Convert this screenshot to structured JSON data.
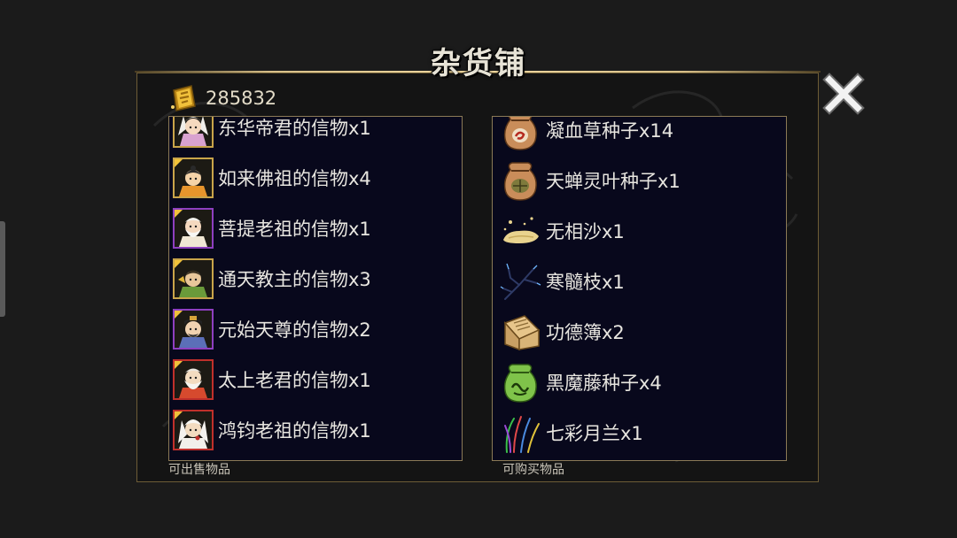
{
  "shop": {
    "title": "杂货铺",
    "currency": {
      "icon": "gold-ingot-icon",
      "amount": "285832"
    },
    "close_icon": "close-icon",
    "sell_label": "可出售物品",
    "buy_label": "可购买物品"
  },
  "sell_items": [
    {
      "name": "东华帝君的信物x1",
      "icon": "donghua-dijun-portrait",
      "rarity": "gold"
    },
    {
      "name": "如来佛祖的信物x4",
      "icon": "rulai-fozu-portrait",
      "rarity": "gold"
    },
    {
      "name": "菩提老祖的信物x1",
      "icon": "puti-laozu-portrait",
      "rarity": "purple"
    },
    {
      "name": "通天教主的信物x3",
      "icon": "tongtian-jiaozhu-portrait",
      "rarity": "gold"
    },
    {
      "name": "元始天尊的信物x2",
      "icon": "yuanshi-tianzun-portrait",
      "rarity": "purple"
    },
    {
      "name": "太上老君的信物x1",
      "icon": "taishang-laojun-portrait",
      "rarity": "red"
    },
    {
      "name": "鸿钧老祖的信物x1",
      "icon": "hongjun-laozu-portrait",
      "rarity": "red"
    }
  ],
  "buy_items": [
    {
      "name": "凝血草种子x14",
      "icon": "seed-bag-red-icon"
    },
    {
      "name": "天蝉灵叶种子x1",
      "icon": "seed-bag-green-icon"
    },
    {
      "name": "无相沙x1",
      "icon": "sand-pile-icon"
    },
    {
      "name": "寒髓枝x1",
      "icon": "blue-branch-icon"
    },
    {
      "name": "功德簿x2",
      "icon": "scroll-book-icon"
    },
    {
      "name": "黑魔藤种子x4",
      "icon": "seed-bag-lime-icon"
    },
    {
      "name": "七彩月兰x1",
      "icon": "rainbow-orchid-icon"
    }
  ],
  "colors": {
    "background": "#1b1b1b",
    "list_background": "#08081c",
    "frame_gold": "#d8c089",
    "rarity_gold": "#c9a44a",
    "rarity_purple": "#8e3fc0",
    "rarity_red": "#c0302b"
  }
}
